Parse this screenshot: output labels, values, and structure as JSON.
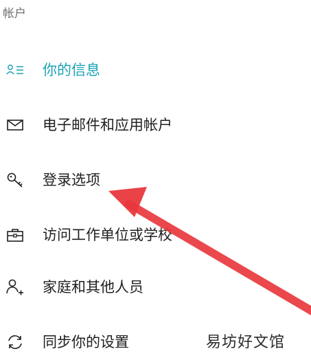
{
  "section": {
    "title": "帐户"
  },
  "nav": {
    "items": [
      {
        "label": "你的信息",
        "icon": "person-list-icon",
        "active": true
      },
      {
        "label": "电子邮件和应用帐户",
        "icon": "mail-icon",
        "active": false
      },
      {
        "label": "登录选项",
        "icon": "key-icon",
        "active": false
      },
      {
        "label": "访问工作单位或学校",
        "icon": "briefcase-icon",
        "active": false
      },
      {
        "label": "家庭和其他人员",
        "icon": "add-person-icon",
        "active": false
      },
      {
        "label": "同步你的设置",
        "icon": "sync-icon",
        "active": false
      }
    ]
  },
  "watermark": {
    "text": "易坊好文馆"
  },
  "colors": {
    "accent": "#1aa3b3",
    "annotation": "#e8383d",
    "text": "#1f1f1f",
    "muted": "#6f6f6f"
  }
}
